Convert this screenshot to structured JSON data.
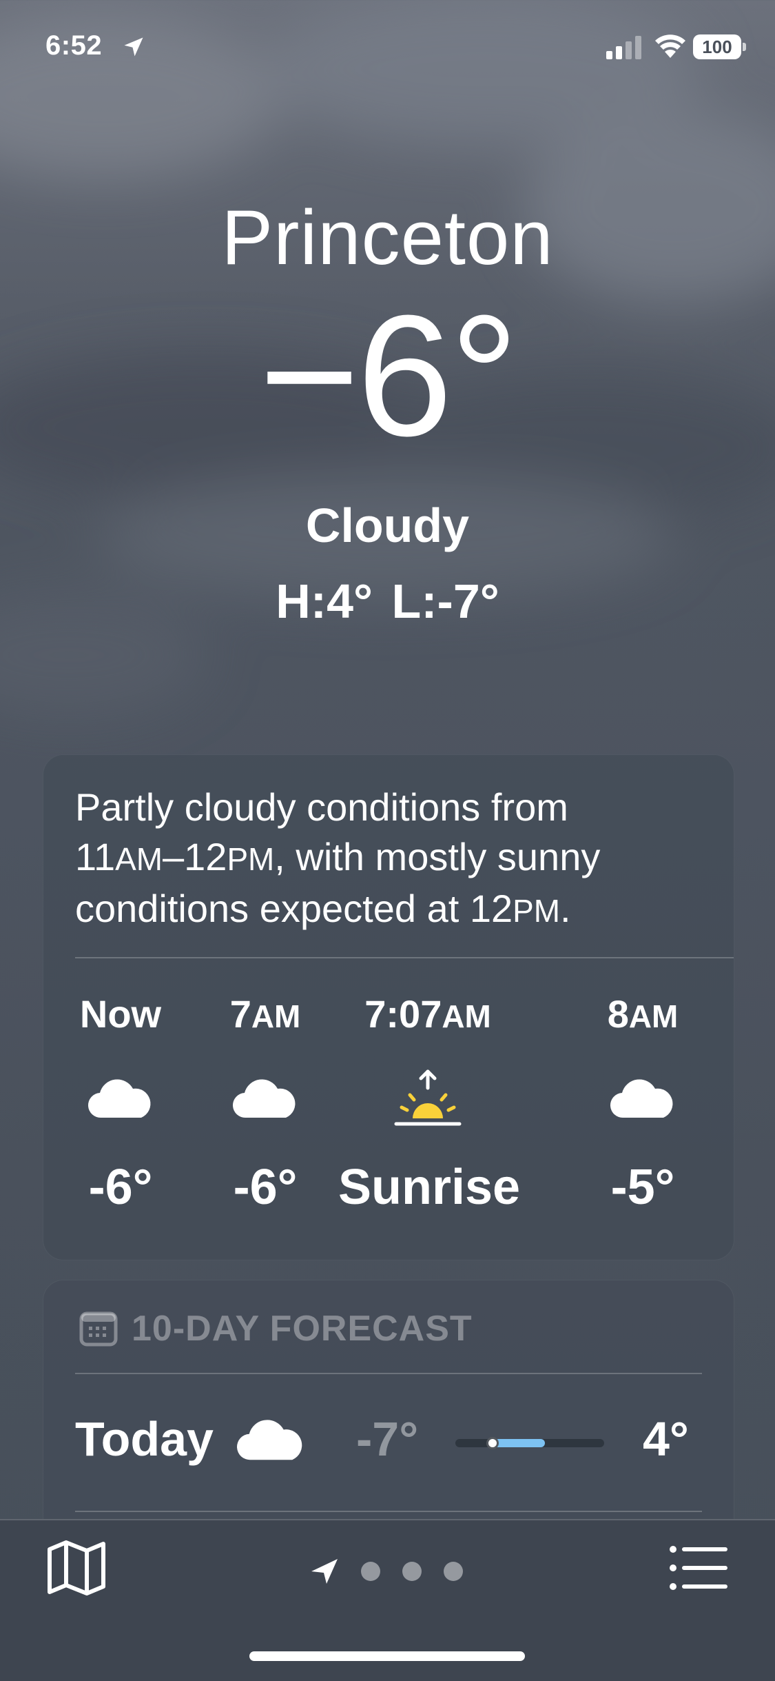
{
  "status_bar": {
    "time": "6:52",
    "battery": "100",
    "icons": [
      "location-arrow-icon",
      "cellular-signal-icon",
      "wifi-icon",
      "battery-icon"
    ]
  },
  "weather": {
    "city": "Princeton",
    "temperature": "−6°",
    "condition": "Cloudy",
    "high_low": "H:4°  L:-7°"
  },
  "hourly_card": {
    "description_parts": {
      "p1": "Partly cloudy conditions from",
      "t1": "11",
      "am": "AM",
      "dash": "–12",
      "pm": "PM",
      "p2": ", with mostly sunny",
      "p3": "conditions expected at 12",
      "pm2": "PM",
      "end": "."
    },
    "hours": [
      {
        "label": "Now",
        "icon": "cloud-icon",
        "temp": "-6°"
      },
      {
        "label_num": "7",
        "label_suffix": "AM",
        "icon": "cloud-icon",
        "temp": "-6°"
      },
      {
        "label_num": "7:07",
        "label_suffix": "AM",
        "icon": "sunrise-icon",
        "temp": "Sunrise"
      },
      {
        "label_num": "8",
        "label_suffix": "AM",
        "icon": "cloud-icon",
        "temp": "-5°"
      }
    ]
  },
  "forecast": {
    "header": "10-DAY FORECAST",
    "header_icon": "calendar-icon",
    "rows": [
      {
        "day": "Today",
        "icon": "cloud-icon",
        "low": "-7°",
        "high": "4°",
        "range_start": 0.25,
        "range_end": 0.6,
        "current": 0.25
      }
    ]
  },
  "tab_bar": {
    "icons": [
      "map-icon",
      "location-arrow-icon",
      "page-dot-icon",
      "list-icon"
    ],
    "pages": 3
  },
  "colors": {
    "sun_yellow": "#f9d13a",
    "temp_bar_blue": "#7dc2f2",
    "background": "#4d5460"
  }
}
